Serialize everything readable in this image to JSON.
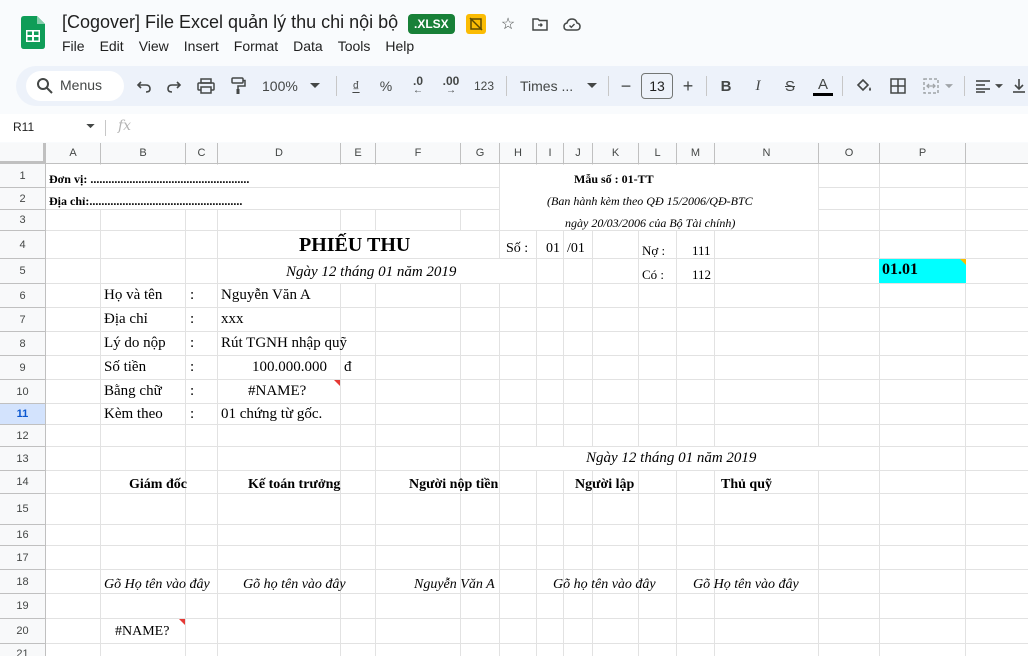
{
  "app": {
    "title": "[Cogover] File Excel quản lý thu chi nội bộ",
    "file_badge": ".XLSX",
    "menu": [
      "File",
      "Edit",
      "View",
      "Insert",
      "Format",
      "Data",
      "Tools",
      "Help"
    ]
  },
  "toolbar": {
    "search_label": "Menus",
    "zoom": "100%",
    "currency": "₫",
    "percent": "%",
    "dec_decrease": ".0",
    "dec_increase": ".00",
    "format_123": "123",
    "font": "Times ...",
    "font_size": "13",
    "bold": "B",
    "italic": "I",
    "strike": "S",
    "text_color": "A"
  },
  "formula_bar": {
    "cell_ref": "R11",
    "fx": "fx",
    "content": ""
  },
  "columns": [
    "A",
    "B",
    "C",
    "D",
    "E",
    "F",
    "G",
    "H",
    "I",
    "J",
    "K",
    "L",
    "M",
    "N",
    "O",
    "P"
  ],
  "rows": [
    "1",
    "2",
    "3",
    "4",
    "5",
    "6",
    "7",
    "8",
    "9",
    "10",
    "11",
    "12",
    "13",
    "14",
    "15",
    "16",
    "17",
    "18",
    "19",
    "20",
    "21"
  ],
  "sheet": {
    "don_vi": "Đơn vị: .....................................................",
    "dia_chi": "Địa chỉ:...................................................",
    "mau_so": "Mẫu số : 01-TT",
    "ban_hanh": "(Ban hành kèm theo QĐ 15/2006/QĐ-BTC",
    "ngay_ban_hanh": "ngày 20/03/2006 của Bộ Tài chính)",
    "phieu_thu": "PHIẾU THU",
    "so_label": "Số  :",
    "so_value": "01",
    "so_suffix": "/01",
    "no_label": "Nợ :",
    "no_value": "111",
    "co_label": "Có :",
    "co_value": "112",
    "p5_value": "01.01",
    "ngay": "Ngày 12 tháng 01 năm 2019",
    "ho_ten_label": "Họ và tên",
    "ho_ten_value": "Nguyễn Văn A",
    "dia_chi_label": "Địa chỉ",
    "dia_chi_value": "xxx",
    "ly_do_label": "Lý do nộp",
    "ly_do_value": "Rút TGNH nhập quỹ",
    "so_tien_label": "Số tiền",
    "so_tien_value": "100.000.000",
    "so_tien_unit": "đ",
    "bang_chu_label": "Bằng chữ",
    "bang_chu_value": "#NAME?",
    "kem_theo_label": "Kèm theo",
    "kem_theo_value": "01 chứng từ gốc.",
    "colon": ":",
    "ngay_ky": "Ngày 12 tháng 01 năm 2019",
    "sig_giam_doc": "Giám đốc",
    "sig_ke_toan": "Kế toán trưởng",
    "sig_nguoi_nop": "Người nộp tiền",
    "sig_nguoi_lap": "Người lập",
    "sig_thu_quy": "Thủ quỹ",
    "name_giam_doc": "Gõ Họ tên vào đây",
    "name_ke_toan": "Gõ họ tên vào đây",
    "name_nguoi_nop": "Nguyễn Văn A",
    "name_nguoi_lap": "Gõ họ tên vào đây",
    "name_thu_quy": "Gõ Họ tên vào đây",
    "name_error": "#NAME?"
  },
  "colors": {
    "brand_green": "#188038",
    "highlight_cyan": "#00ffff",
    "toolbar_bg": "#edf2fa",
    "selected_row": "#d3e3fd"
  }
}
